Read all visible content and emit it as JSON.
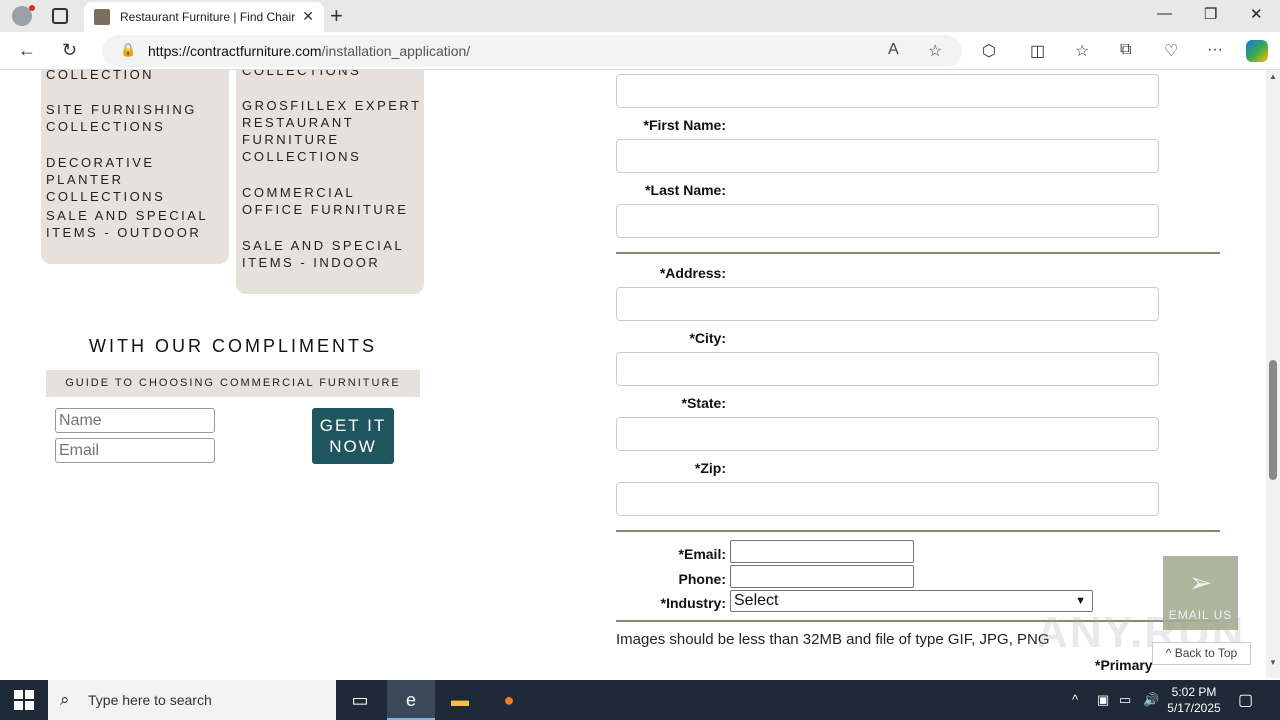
{
  "browser": {
    "tab_title": "Restaurant Furniture | Find Chairs",
    "url_domain": "https://contractfurniture.com",
    "url_path": "/installation_application/",
    "tab_close": "✕",
    "new_tab": "+",
    "minimize": "—",
    "maximize": "❐",
    "close": "✕"
  },
  "sidebar": {
    "left_items": [
      "COLLECTION",
      "SITE FURNISHING COLLECTIONS",
      "DECORATIVE PLANTER COLLECTIONS",
      "SALE AND SPECIAL ITEMS - OUTDOOR"
    ],
    "right_items": [
      "COLLECTIONS",
      "GROSFILLEX EXPERT RESTAURANT FURNITURE COLLECTIONS",
      "COMMERCIAL OFFICE FURNITURE",
      "SALE AND SPECIAL ITEMS - INDOOR"
    ],
    "compliments_title": "WITH OUR COMPLIMENTS",
    "guide_title": "GUIDE TO CHOOSING COMMERCIAL FURNITURE",
    "name_placeholder": "Name",
    "email_placeholder": "Email",
    "get_button": "GET IT NOW"
  },
  "form": {
    "first_name_label": "*First Name:",
    "last_name_label": "*Last Name:",
    "address_label": "*Address:",
    "city_label": "*City:",
    "state_label": "*State:",
    "zip_label": "*Zip:",
    "email_label": "*Email:",
    "phone_label": "Phone:",
    "industry_label": "*Industry:",
    "industry_selected": "Select",
    "images_note": "Images should be less than 32MB and file of type GIF, JPG, PNG",
    "primary_label": "*Primary"
  },
  "floating": {
    "email_us": "EMAIL US",
    "back_to_top": "^ Back to Top"
  },
  "taskbar": {
    "search_placeholder": "Type here to search",
    "time": "5:02 PM",
    "date": "5/17/2025"
  },
  "watermark": "ANY.RUN",
  "colors": {
    "menu_bg": "#e7e1db",
    "button_teal": "#1f5660",
    "divider": "#8a8670",
    "email_us_bg": "#a5ad94",
    "taskbar_bg": "#1e2a38"
  }
}
